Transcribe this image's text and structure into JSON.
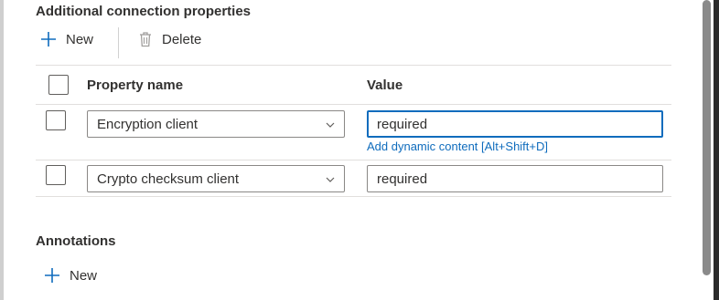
{
  "connection_properties": {
    "title": "Additional connection properties",
    "toolbar": {
      "new_label": "New",
      "delete_label": "Delete"
    },
    "table": {
      "columns": {
        "property_name": "Property name",
        "value": "Value"
      },
      "rows": [
        {
          "property": "Encryption client",
          "value": "required",
          "focused": true,
          "dynamic_content_label": "Add dynamic content [Alt+Shift+D]"
        },
        {
          "property": "Crypto checksum client",
          "value": "required",
          "focused": false
        }
      ]
    }
  },
  "annotations": {
    "title": "Annotations",
    "new_label": "New"
  },
  "colors": {
    "accent": "#0f6cbd",
    "text": "#323130",
    "border": "#8a8886"
  },
  "icons": {
    "new": "add-icon",
    "delete": "trash-icon",
    "dropdown": "chevron-down-icon"
  }
}
